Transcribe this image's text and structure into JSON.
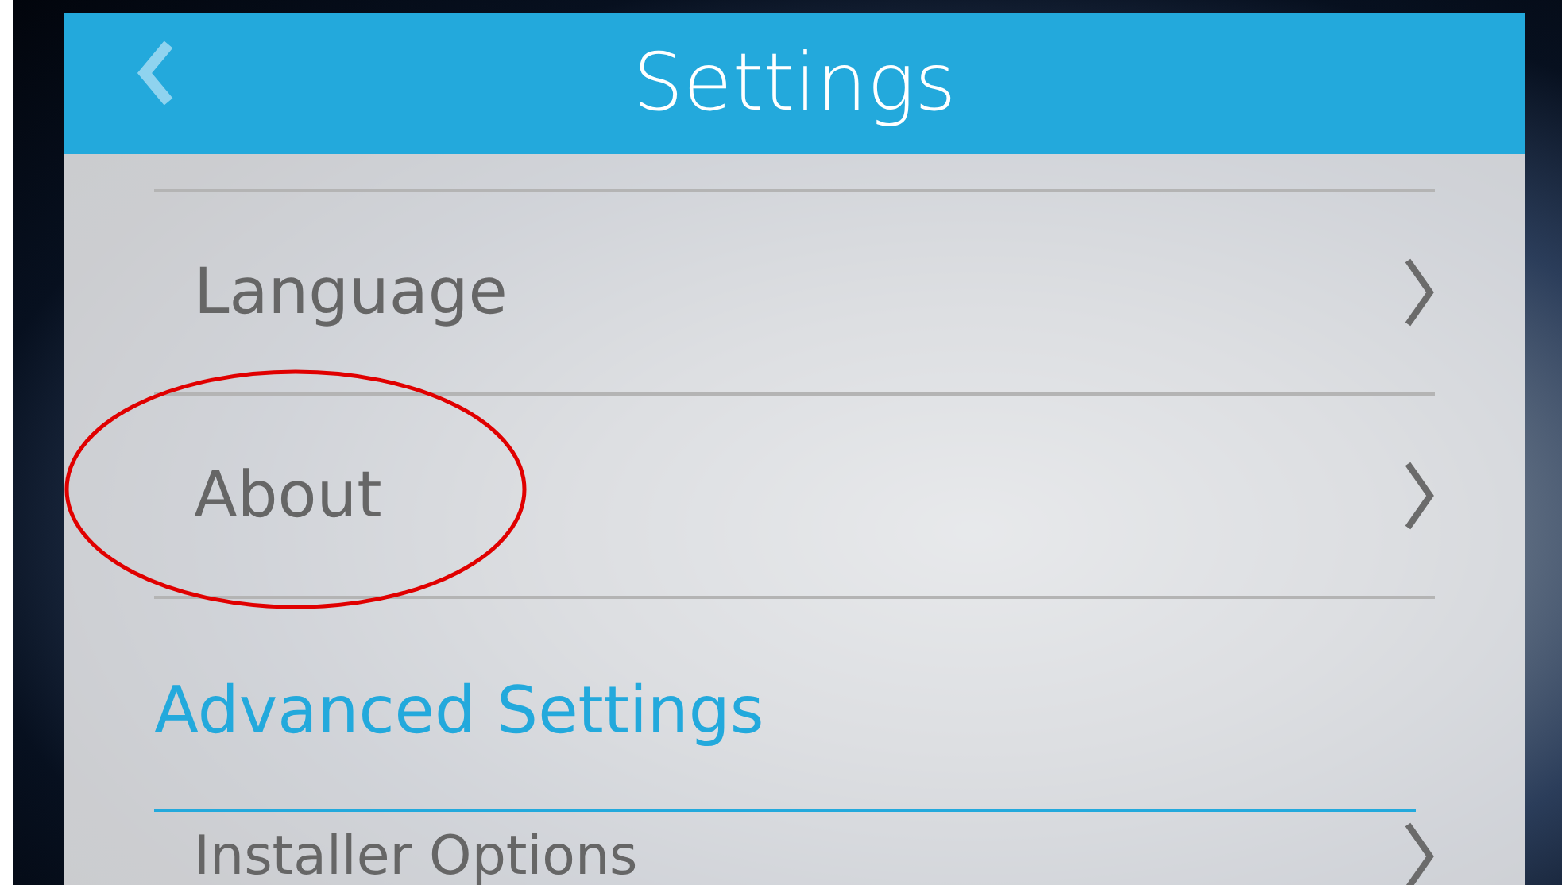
{
  "settings_panel": {
    "title": "Settings",
    "items": [
      {
        "label": "Language",
        "highlighted": false
      },
      {
        "label": "About",
        "highlighted": true
      }
    ],
    "section": {
      "title": "Advanced Settings",
      "items": [
        {
          "label": "Installer Options"
        }
      ]
    }
  }
}
